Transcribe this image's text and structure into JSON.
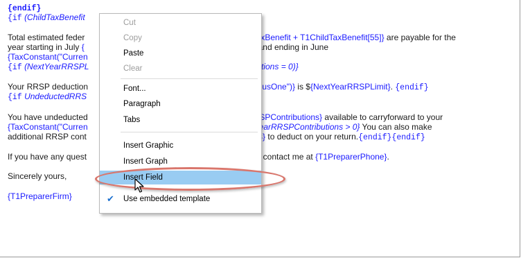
{
  "doc": {
    "l1_endif": "{endif}",
    "l2_if": "{if",
    "l2_expr": "(ChildTaxBenefit",
    "l4_text": "Total estimated feder",
    "l4_right_blue": "dTaxBenefit + T1ChildTaxBenefit[55]}",
    "l4_right_tail": " are payable for the",
    "l5_text": "year starting in July",
    "l5_blue": "{",
    "l5_right_blue": "\")}",
    "l5_right_tail": " and ending in June",
    "l6_text": "{TaxConstant(\"Curren",
    "l7_if": "{if",
    "l7_expr": "(NextYearRRSPL",
    "l7_right": "ributions = 0)}",
    "l9_text": "Your RRSP deduction",
    "l9_right_blue": "arPlusOne\")}",
    "l9_right_mid": " is $",
    "l9_right_blue2": "{NextYearRRSPLimit}",
    "l9_right_dot": ". ",
    "l9_endif": "{endif}",
    "l10_if": "{if",
    "l10_expr": "UndeductedRRS",
    "l12_text": "You have undeducted",
    "l12_right_blue": "RRSPContributions}",
    "l12_right_tail": " available to carryforward to your",
    "l13_text": "{TaxConstant(\"Curren",
    "l13_right": "xtYearRRSPContributions > 0}",
    "l13_tail": "  You can also make",
    "l14_text": "additional RRSP cont",
    "l14_right_blue": "ions}",
    "l14_right_mid": " to deduct on your return.",
    "l14_endifs": "{endif}{endif}",
    "l16_text": "If you have any quest",
    "l16_right": "ase contact me at ",
    "l16_phone": "{T1PreparerPhone}",
    "l16_dot": ".",
    "l18_text": "Sincerely yours,",
    "l20_text": "{T1PreparerFirm}"
  },
  "context_menu": {
    "items": [
      {
        "label": "Cut",
        "enabled": false
      },
      {
        "label": "Copy",
        "enabled": false
      },
      {
        "label": "Paste",
        "enabled": true
      },
      {
        "label": "Clear",
        "enabled": false
      },
      {
        "label": "Font...",
        "enabled": true
      },
      {
        "label": "Paragraph",
        "enabled": true
      },
      {
        "label": "Tabs",
        "enabled": true
      },
      {
        "label": "Insert Graphic",
        "enabled": true
      },
      {
        "label": "Insert Graph",
        "enabled": true
      },
      {
        "label": "Insert Field",
        "enabled": true,
        "highlighted": true
      },
      {
        "label": "Use embedded template",
        "enabled": true,
        "checked": true
      }
    ]
  },
  "colors": {
    "field_blue": "#1a1aff",
    "highlight": "#99ccf2",
    "annotation_oval": "#d9766c"
  },
  "icons": {
    "check": "checkmark-icon",
    "cursor": "arrow-cursor-icon"
  }
}
